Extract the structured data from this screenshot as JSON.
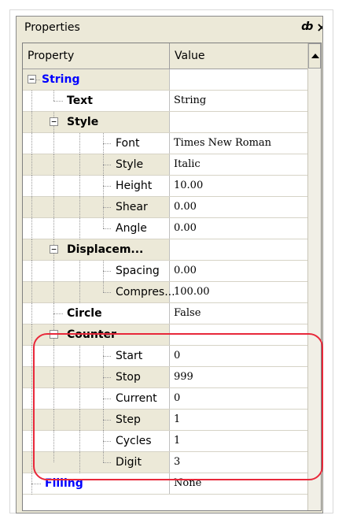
{
  "panel": {
    "title": "Properties",
    "pin_glyph": "ё",
    "close_glyph": "×"
  },
  "header": {
    "property": "Property",
    "value": "Value"
  },
  "rows": [
    {
      "label": "String",
      "value": ""
    },
    {
      "label": "Text",
      "value": "String"
    },
    {
      "label": "Style",
      "value": ""
    },
    {
      "label": "Font",
      "value": "Times New Roman"
    },
    {
      "label": "Style",
      "value": "Italic"
    },
    {
      "label": "Height",
      "value": "10.00"
    },
    {
      "label": "Shear",
      "value": "0.00"
    },
    {
      "label": "Angle",
      "value": "0.00"
    },
    {
      "label": "Displacem...",
      "value": ""
    },
    {
      "label": "Spacing",
      "value": "0.00"
    },
    {
      "label": "Compres...",
      "value": "100.00"
    },
    {
      "label": "Circle",
      "value": "False"
    },
    {
      "label": "Counter",
      "value": ""
    },
    {
      "label": "Start",
      "value": "0"
    },
    {
      "label": "Stop",
      "value": "999"
    },
    {
      "label": "Current",
      "value": "0"
    },
    {
      "label": "Step",
      "value": "1"
    },
    {
      "label": "Cycles",
      "value": "1"
    },
    {
      "label": "Digit",
      "value": "3"
    },
    {
      "label": "Filling",
      "value": "None"
    }
  ],
  "colors": {
    "category_text": "#0000ff",
    "highlight": "#e8283a",
    "panel_bg": "#ece9d8"
  },
  "icons": {
    "expand_toggle": "minus-box-icon",
    "pin": "pin-icon",
    "close": "close-icon",
    "scroll_up": "up-arrow-icon"
  }
}
